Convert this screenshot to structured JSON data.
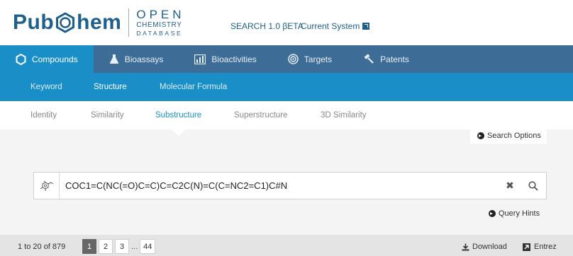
{
  "header": {
    "logo_left": "Pub",
    "logo_right": "hem",
    "logo_open": "OPEN",
    "logo_chemistry": "CHEMISTRY",
    "logo_database": "DATABASE",
    "search_beta": "SEARCH 1.0 βETA",
    "current_system": "Current System"
  },
  "main_nav": [
    {
      "label": "Compounds",
      "icon": "hexagon-icon",
      "active": true
    },
    {
      "label": "Bioassays",
      "icon": "flask-icon",
      "active": false
    },
    {
      "label": "Bioactivities",
      "icon": "bar-chart-icon",
      "active": false
    },
    {
      "label": "Targets",
      "icon": "target-icon",
      "active": false
    },
    {
      "label": "Patents",
      "icon": "gavel-icon",
      "active": false
    }
  ],
  "sub_nav": [
    {
      "label": "Keyword",
      "active": false
    },
    {
      "label": "Structure",
      "active": true
    },
    {
      "label": "Molecular Formula",
      "active": false
    }
  ],
  "third_nav": [
    {
      "label": "Identity",
      "active": false
    },
    {
      "label": "Similarity",
      "active": false
    },
    {
      "label": "Substructure",
      "active": true
    },
    {
      "label": "Superstructure",
      "active": false
    },
    {
      "label": "3D Similarity",
      "active": false
    }
  ],
  "search_options_label": "Search Options",
  "search": {
    "value": "COC1=C(NC(=O)C=C)C=C2C(N)=C(C=NC2=C1)C#N",
    "placeholder": ""
  },
  "query_hints_label": "Query Hints",
  "results": {
    "count_text": "1 to 20 of 879",
    "pages": [
      "1",
      "2",
      "3"
    ],
    "ellipsis": "...",
    "last_page": "44",
    "current_page": "1"
  },
  "download_label": "Download",
  "entrez_label": "Entrez",
  "colors": {
    "brand": "#1f5f8b",
    "main_nav_bg": "#3d6d96",
    "accent": "#1a8fc7",
    "page_bg": "#f4f4f4"
  }
}
